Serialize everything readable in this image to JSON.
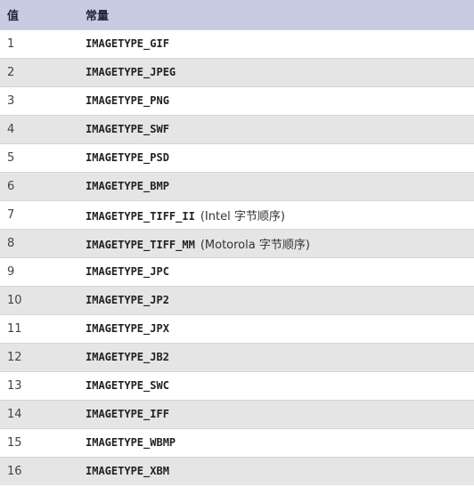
{
  "table": {
    "headers": {
      "value": "值",
      "constant": "常量"
    },
    "rows": [
      {
        "value": "1",
        "constant": "IMAGETYPE_GIF",
        "note": ""
      },
      {
        "value": "2",
        "constant": "IMAGETYPE_JPEG",
        "note": ""
      },
      {
        "value": "3",
        "constant": "IMAGETYPE_PNG",
        "note": ""
      },
      {
        "value": "4",
        "constant": "IMAGETYPE_SWF",
        "note": ""
      },
      {
        "value": "5",
        "constant": "IMAGETYPE_PSD",
        "note": ""
      },
      {
        "value": "6",
        "constant": "IMAGETYPE_BMP",
        "note": ""
      },
      {
        "value": "7",
        "constant": "IMAGETYPE_TIFF_II",
        "note": "(Intel 字节顺序)"
      },
      {
        "value": "8",
        "constant": "IMAGETYPE_TIFF_MM",
        "note": "(Motorola 字节顺序)"
      },
      {
        "value": "9",
        "constant": "IMAGETYPE_JPC",
        "note": ""
      },
      {
        "value": "10",
        "constant": "IMAGETYPE_JP2",
        "note": ""
      },
      {
        "value": "11",
        "constant": "IMAGETYPE_JPX",
        "note": ""
      },
      {
        "value": "12",
        "constant": "IMAGETYPE_JB2",
        "note": ""
      },
      {
        "value": "13",
        "constant": "IMAGETYPE_SWC",
        "note": ""
      },
      {
        "value": "14",
        "constant": "IMAGETYPE_IFF",
        "note": ""
      },
      {
        "value": "15",
        "constant": "IMAGETYPE_WBMP",
        "note": ""
      },
      {
        "value": "16",
        "constant": "IMAGETYPE_XBM",
        "note": ""
      }
    ]
  },
  "colors": {
    "header_background": "#c8cbe2",
    "row_odd": "#ffffff",
    "row_even": "#e5e5e5"
  }
}
